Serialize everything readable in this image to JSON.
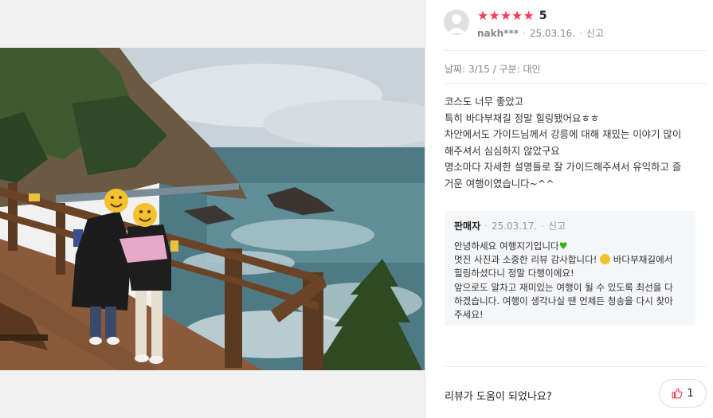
{
  "review": {
    "stars": [
      "★",
      "★",
      "★",
      "★",
      "★"
    ],
    "rating": "5",
    "user": "nakh***",
    "date": "25.03.16.",
    "report_label": "신고",
    "info": "날짜: 3/15 / 구분: 대인",
    "lines": [
      "코스도 너무 좋았고",
      "특히 바다부채길 정말 힐링됐어요ㅎㅎ",
      "차안에서도 가이드님께서 강릉에 대해 재밌는 이야기 많이",
      "해주셔서 심심하지 않았구요",
      "명소마다 자세한 설명들로 잘 가이드해주셔서 유익하고 즐",
      "거운 여행이였습니다~^^"
    ]
  },
  "reply": {
    "seller": "판매자",
    "date": "25.03.17.",
    "report_label": "신고",
    "line1": "안녕하세요 여행지기입니다",
    "line2a": "멋진 사진과 소중한 리뷰 감사합니다!",
    "line2b": " 바다부채길에서",
    "line3": "힐링하셨다니 정말 다행이에요!",
    "line4": "앞으로도 알차고 재미있는 여행이 될 수 있도록 최선을 다",
    "line5": "하겠습니다. 여행이 생각나실 땐 언제든 청송을 다시 찾아",
    "line6": "주세요!"
  },
  "footer": {
    "helpful_label": "리뷰가 도움이 되었나요?",
    "like_count": "1"
  },
  "colors": {
    "star": "#ff3b57",
    "heart": "#2db400",
    "reply_bg": "#f5f6f8"
  }
}
